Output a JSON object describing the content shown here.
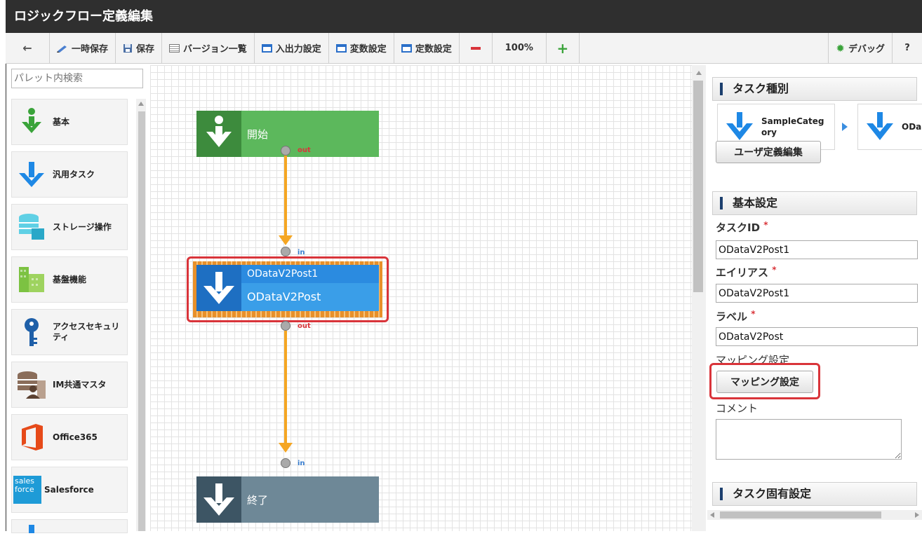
{
  "title": "ロジックフロー定義編集",
  "toolbar": {
    "temp_save": "一時保存",
    "save": "保存",
    "versions": "バージョン一覧",
    "io_settings": "入出力設定",
    "var_settings": "変数設定",
    "const_settings": "定数設定",
    "zoom": "100%",
    "debug": "デバッグ",
    "help": "?"
  },
  "palette": {
    "search_placeholder": "パレット内検索",
    "items": [
      {
        "label": "基本",
        "icon": "green-down-arrow-icon"
      },
      {
        "label": "汎用タスク",
        "icon": "blue-down-arrow-icon"
      },
      {
        "label": "ストレージ操作",
        "icon": "storage-icon"
      },
      {
        "label": "基盤機能",
        "icon": "grid-blocks-icon"
      },
      {
        "label": "アクセスセキュリティ",
        "icon": "key-icon"
      },
      {
        "label": "IM共通マスタ",
        "icon": "database-user-icon"
      },
      {
        "label": "Office365",
        "icon": "office-icon"
      },
      {
        "label": "Salesforce",
        "icon": "salesforce-icon"
      }
    ],
    "salesforce_logo_text": "sales force"
  },
  "flow": {
    "start_label": "開始",
    "task_name": "ODataV2Post1",
    "task_type": "ODataV2Post",
    "end_label": "終了",
    "port_out": "out",
    "port_in": "in"
  },
  "panel": {
    "task_type_title": "タスク種別",
    "category": "SampleCateg ory",
    "category_next": "ODa",
    "user_def_button": "ユーザ定義編集",
    "basic_title": "基本設定",
    "task_id_label": "タスクID",
    "task_id_value": "ODataV2Post1",
    "alias_label": "エイリアス",
    "alias_value": "ODataV2Post1",
    "label_label": "ラベル",
    "label_value": "ODataV2Post",
    "mapping_label": "マッピング設定",
    "mapping_button": "マッピング設定",
    "comment_label": "コメント",
    "task_specific_title": "タスク固有設定",
    "required_mark": "*"
  },
  "colors": {
    "start_green": "#5cb85c",
    "task_blue": "#3a9ee8",
    "end_gray": "#6e8897",
    "connector_orange": "#f5a623",
    "highlight_red": "#d9343a"
  }
}
